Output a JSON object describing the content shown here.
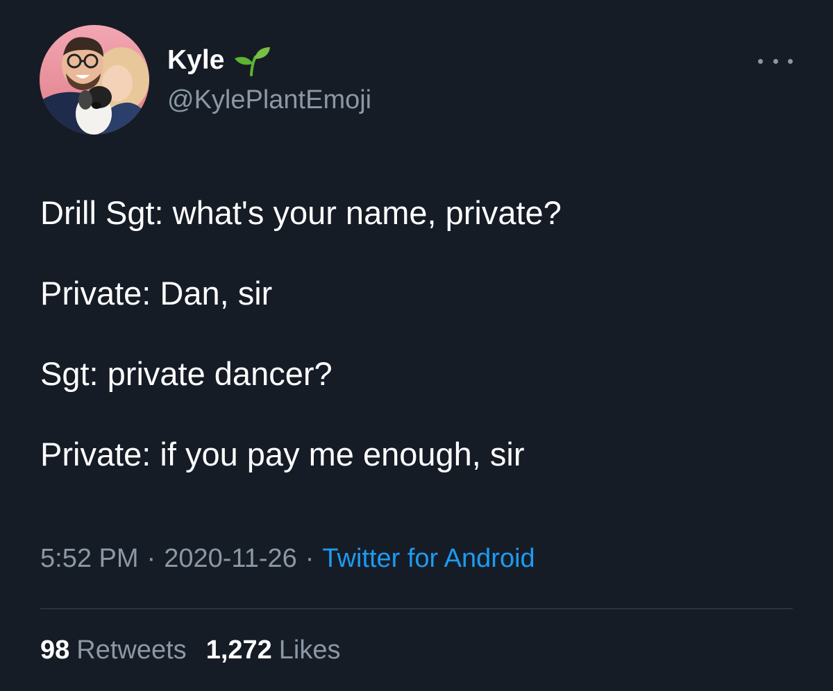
{
  "user": {
    "display_name": "Kyle",
    "handle": "@KylePlantEmoji",
    "name_emoji": "seedling-icon"
  },
  "tweet": {
    "lines": [
      "Drill Sgt: what's your name, private?",
      "Private: Dan, sir",
      "Sgt: private dancer?",
      "Private: if you pay me enough, sir"
    ]
  },
  "meta": {
    "time": "5:52 PM",
    "separator": "·",
    "date": "2020-11-26",
    "source": "Twitter for Android"
  },
  "stats": {
    "retweets_count": "98",
    "retweets_label": "Retweets",
    "likes_count": "1,272",
    "likes_label": "Likes"
  },
  "colors": {
    "background": "#161c26",
    "secondary_text": "#8b98a5",
    "link": "#1d9bf0",
    "divider": "#38444d"
  }
}
